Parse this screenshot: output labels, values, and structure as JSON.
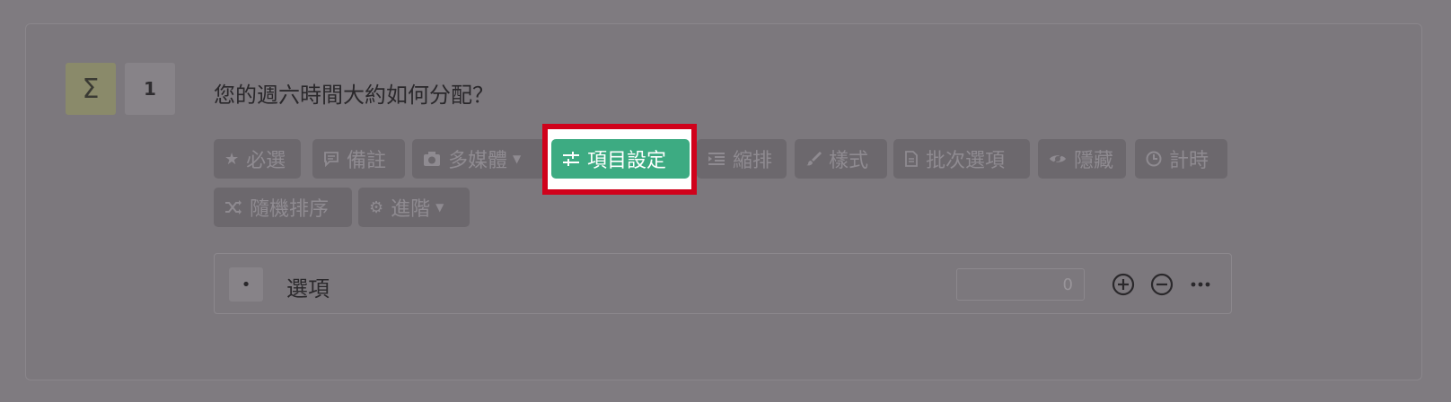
{
  "question": {
    "type_icon": "sigma-icon",
    "type_symbol": "Σ",
    "number": "1",
    "text": "您的週六時間大約如何分配？"
  },
  "toolbar": {
    "required": "必選",
    "note": "備註",
    "media": "多媒體",
    "item_settings": "項目設定",
    "indent": "縮排",
    "style": "樣式",
    "batch_options": "批次選項",
    "hide": "隱藏",
    "timer": "計時",
    "random_order": "隨機排序",
    "advanced": "進階"
  },
  "option": {
    "bullet": "•",
    "label": "選項",
    "score_value": "0"
  },
  "colors": {
    "active_button": "#3dab82",
    "highlight_border": "#d0021b"
  }
}
